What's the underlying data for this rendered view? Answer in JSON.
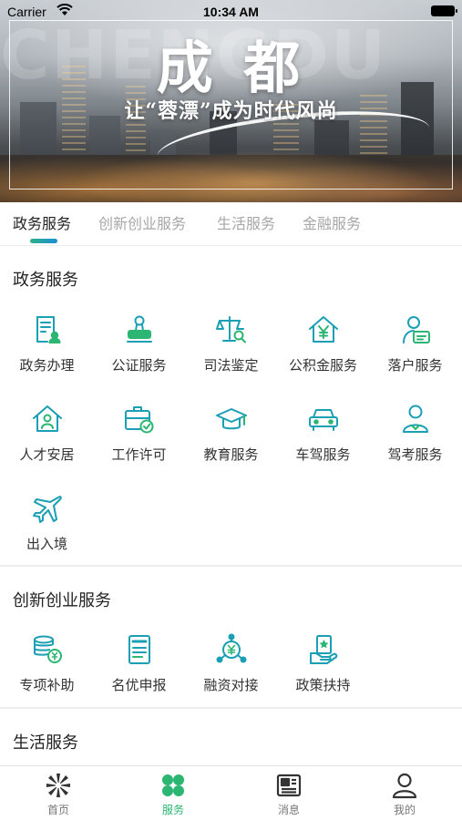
{
  "status_bar": {
    "carrier": "Carrier",
    "time": "10:34 AM"
  },
  "banner": {
    "watermark": "CHENGDU",
    "title": "成 都",
    "slogan": "让“蓉漂”成为时代风尚"
  },
  "tabs": [
    {
      "label": "政务服务",
      "active": true
    },
    {
      "label": "创新创业服务",
      "active": false
    },
    {
      "label": "生活服务",
      "active": false
    },
    {
      "label": "金融服务",
      "active": false
    }
  ],
  "sections": [
    {
      "title": "政务服务",
      "items": [
        {
          "label": "政务办理",
          "icon": "document-user-icon"
        },
        {
          "label": "公证服务",
          "icon": "stamp-icon"
        },
        {
          "label": "司法鉴定",
          "icon": "scales-search-icon"
        },
        {
          "label": "公积金服务",
          "icon": "house-yuan-icon"
        },
        {
          "label": "落户服务",
          "icon": "person-card-icon"
        },
        {
          "label": "人才安居",
          "icon": "house-person-icon"
        },
        {
          "label": "工作许可",
          "icon": "briefcase-check-icon"
        },
        {
          "label": "教育服务",
          "icon": "graduation-cap-icon"
        },
        {
          "label": "车驾服务",
          "icon": "car-icon"
        },
        {
          "label": "驾考服务",
          "icon": "user-badge-icon"
        },
        {
          "label": "出入境",
          "icon": "airplane-icon"
        }
      ]
    },
    {
      "title": "创新创业服务",
      "items": [
        {
          "label": "专项补助",
          "icon": "coins-icon"
        },
        {
          "label": "名优申报",
          "icon": "certificate-icon"
        },
        {
          "label": "融资对接",
          "icon": "money-network-icon"
        },
        {
          "label": "政策扶持",
          "icon": "hand-document-icon"
        }
      ]
    },
    {
      "title": "生活服务",
      "items": []
    }
  ],
  "bottom_nav": [
    {
      "label": "首页",
      "icon": "home-pinwheel-icon",
      "active": false
    },
    {
      "label": "服务",
      "icon": "clover-grid-icon",
      "active": true
    },
    {
      "label": "消息",
      "icon": "newspaper-icon",
      "active": false
    },
    {
      "label": "我的",
      "icon": "user-icon",
      "active": false
    }
  ],
  "colors": {
    "accent_teal": "#1a9fb5",
    "accent_green": "#2bb673",
    "inactive_tab": "#a7a7a7"
  }
}
